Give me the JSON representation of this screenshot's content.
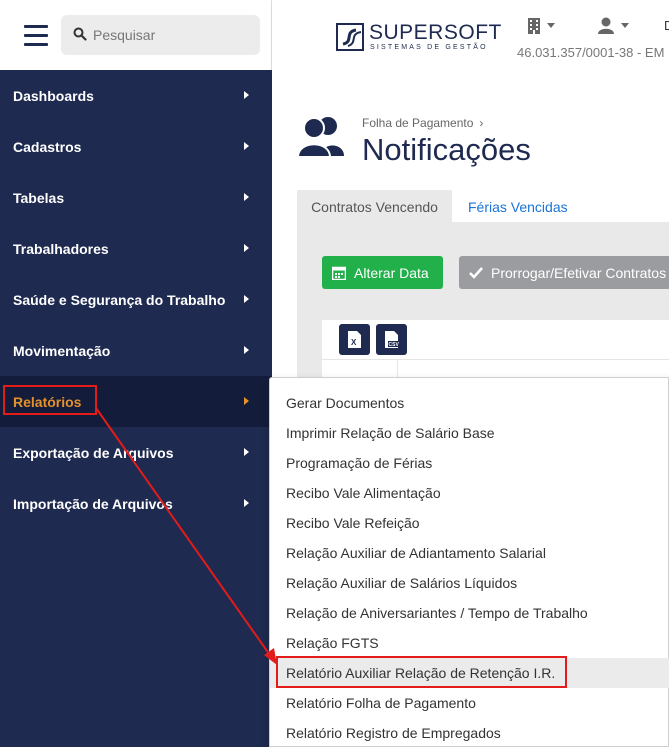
{
  "search": {
    "placeholder": "Pesquisar"
  },
  "sidebar": {
    "items": [
      {
        "label": "Dashboards"
      },
      {
        "label": "Cadastros"
      },
      {
        "label": "Tabelas"
      },
      {
        "label": "Trabalhadores"
      },
      {
        "label": "Saúde e Segurança do Trabalho"
      },
      {
        "label": "Movimentação"
      },
      {
        "label": "Relatórios",
        "active": true
      },
      {
        "label": "Exportação de Arquivos"
      },
      {
        "label": "Importação de Arquivos"
      }
    ]
  },
  "header": {
    "logo_name": "SUPERSOFT",
    "logo_sub": "SISTEMAS DE GESTÃO",
    "company_id": "46.031.357/0001-38 - EM",
    "right_letter": "D"
  },
  "page": {
    "breadcrumb": "Folha de Pagamento",
    "title": "Notificações"
  },
  "tabs": [
    {
      "label": "Contratos Vencendo"
    },
    {
      "label": "Férias Vencidas"
    }
  ],
  "actions": {
    "alter_date": "Alterar Data",
    "extend": "Prorrogar/Efetivar Contratos"
  },
  "export": {
    "xls_icon": "excel-file-icon",
    "csv_icon": "csv-file-icon"
  },
  "dropdown": {
    "items": [
      {
        "label": "Gerar Documentos"
      },
      {
        "label": "Imprimir Relação de Salário Base"
      },
      {
        "label": "Programação de Férias"
      },
      {
        "label": "Recibo Vale Alimentação"
      },
      {
        "label": "Recibo Vale Refeição"
      },
      {
        "label": "Relação Auxiliar de Adiantamento Salarial"
      },
      {
        "label": "Relação Auxiliar de Salários Líquidos"
      },
      {
        "label": "Relação de Aniversariantes / Tempo de Trabalho"
      },
      {
        "label": "Relação FGTS"
      },
      {
        "label": "Relatório Auxiliar Relação de Retenção I.R.",
        "highlighted": true
      },
      {
        "label": "Relatório Folha de Pagamento"
      },
      {
        "label": "Relatório Registro de Empregados"
      }
    ]
  },
  "colors": {
    "sidebar_bg": "#1e2a4f",
    "active_text": "#e4912b",
    "green_button": "#22b04b",
    "annotation_red": "#e21b1b"
  }
}
